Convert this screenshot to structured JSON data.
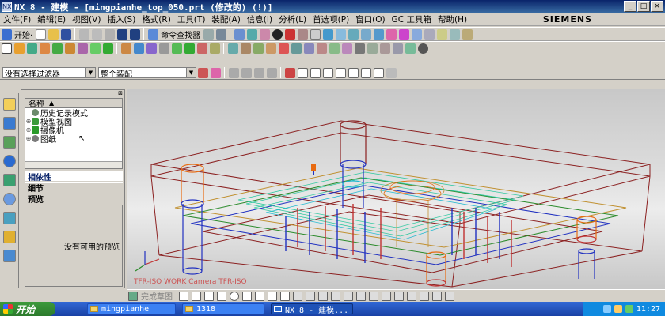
{
  "window": {
    "title": "NX 8 - 建模 - [mingpianhe_top_050.prt  (修改的)      (!)]",
    "brand": "SIEMENS",
    "buttons": [
      "minimize",
      "maximize",
      "close"
    ]
  },
  "menu": [
    "文件(F)",
    "编辑(E)",
    "视图(V)",
    "插入(S)",
    "格式(R)",
    "工具(T)",
    "装配(A)",
    "信息(I)",
    "分析(L)",
    "首选项(P)",
    "窗口(O)",
    "GC 工具箱",
    "帮助(H)"
  ],
  "toolbar": {
    "start_label": "开始·",
    "command_finder_label": "命令查找器"
  },
  "filters": {
    "selection_filter": "没有选择过滤器",
    "scope": "整个装配"
  },
  "navigator": {
    "column_header": "名称",
    "nodes": [
      {
        "label": "历史记录模式",
        "icon": "history-icon"
      },
      {
        "label": "模型视图",
        "icon": "model-view-icon"
      },
      {
        "label": "摄像机",
        "icon": "camera-icon"
      },
      {
        "label": "图纸",
        "icon": "drawing-icon"
      }
    ],
    "sections": {
      "dependencies": "相依性",
      "details": "细节",
      "preview": "预览"
    },
    "preview_empty": "没有可用的预览"
  },
  "viewport": {
    "camera_label": "TFR-ISO WORK Camera TFR-ISO"
  },
  "statusbar": {
    "text": "完成草图"
  },
  "taskbar": {
    "start": "开始",
    "tasks": [
      "mingpianhe",
      "1318",
      "NX 8 - 建模..."
    ],
    "clock": "11:27"
  },
  "colors": {
    "titlebar": "#0a246a",
    "mold_frame": "#8b2020",
    "guide_orange": "#e86a10",
    "pin_blue": "#2030c0",
    "part_green": "#30c8a0",
    "cavity_cyan": "#20b8d0"
  }
}
